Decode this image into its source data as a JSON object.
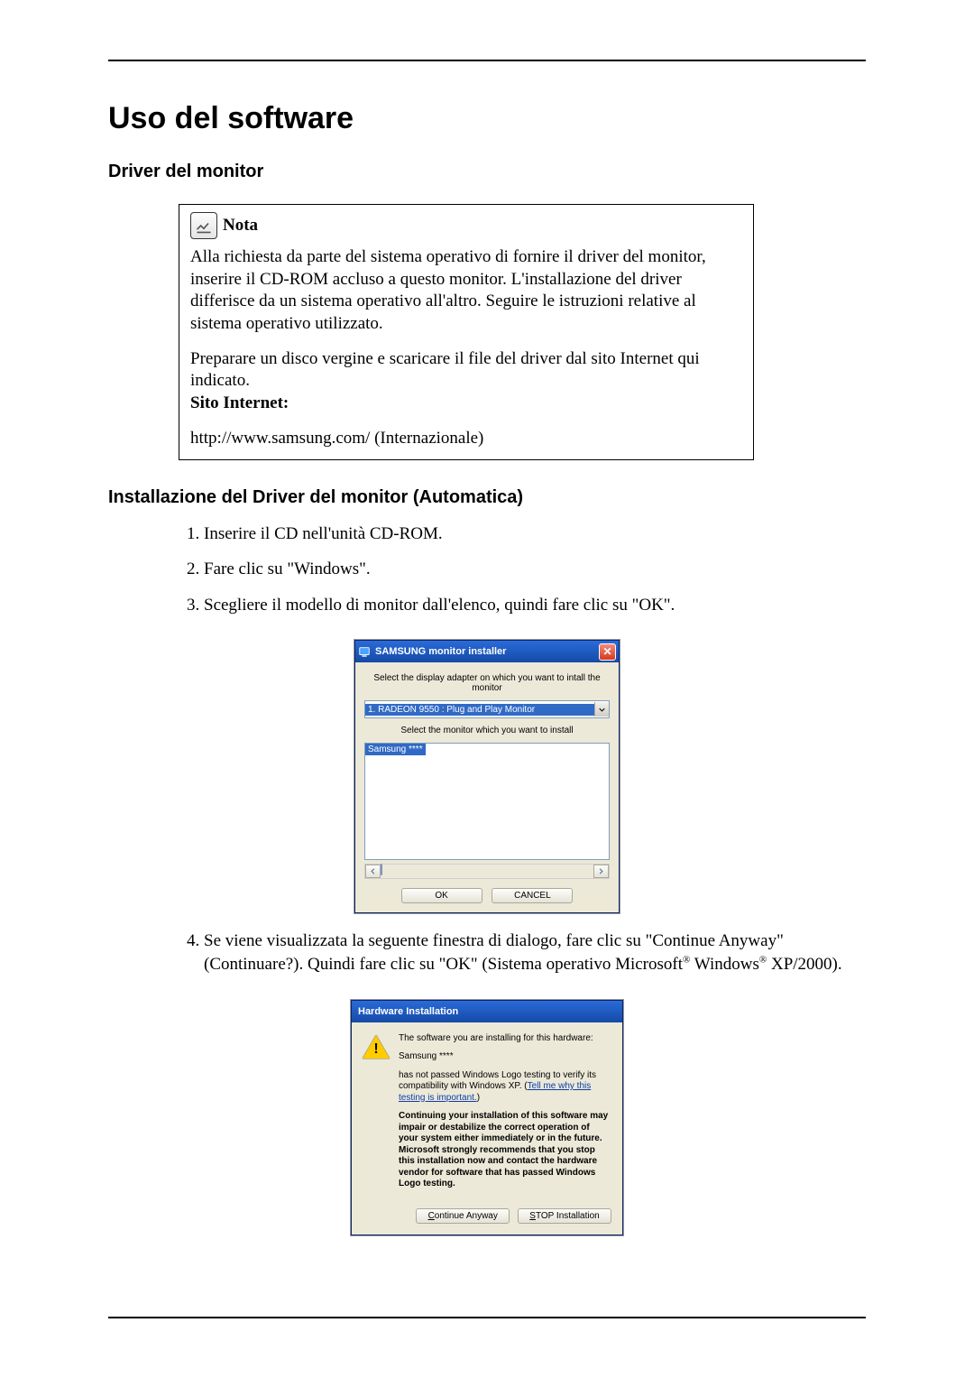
{
  "page": {
    "title": "Uso del software",
    "section_driver": "Driver del monitor",
    "note_label": "Nota",
    "note_p1": "Alla richiesta da parte del sistema operativo di fornire il driver del monitor, inserire il CD-ROM accluso a questo monitor. L'installazione del driver differisce da un sistema operativo all'altro. Seguire le istruzioni relative al sistema operativo utilizzato.",
    "note_p2": "Preparare un disco vergine e scaricare il file del driver dal sito Internet qui indicato.",
    "note_site_label": "Sito Internet:",
    "note_site_url": "http://www.samsung.com/ (Internazionale)",
    "section_install": "Installazione del Driver del monitor (Automatica)",
    "steps": {
      "s1": "Inserire il CD nell'unità CD-ROM.",
      "s2": "Fare clic su \"Windows\".",
      "s3": "Scegliere il modello di monitor dall'elenco, quindi fare clic su \"OK\".",
      "s4a": "Se viene visualizzata la seguente finestra di dialogo, fare clic su \"Continue Anyway\" (Continuare?). Quindi fare clic su \"OK\" (Sistema operativo Microsoft",
      "s4b": " Windows",
      "s4c": " XP/2000)."
    }
  },
  "installer": {
    "title": "SAMSUNG monitor installer",
    "label_adapter": "Select the display adapter on which you want to intall the monitor",
    "select_value": "1. RADEON 9550 : Plug and Play Monitor",
    "label_monitor": "Select the monitor which you want to install",
    "list_selected": "Samsung ****",
    "btn_ok": "OK",
    "btn_cancel": "CANCEL"
  },
  "hwdlg": {
    "title": "Hardware Installation",
    "line1": "The software you are installing for this hardware:",
    "line2": "Samsung ****",
    "line3a": "has not passed Windows Logo testing to verify its compatibility with Windows XP. (",
    "link": "Tell me why this testing is important.",
    "line3b": ")",
    "bold": "Continuing your installation of this software may impair or destabilize the correct operation of your system either immediately or in the future. Microsoft strongly recommends that you stop this installation now and contact the hardware vendor for software that has passed Windows Logo testing.",
    "btn_continue_full": "Continue Anyway",
    "btn_stop_full": "STOP Installation"
  }
}
